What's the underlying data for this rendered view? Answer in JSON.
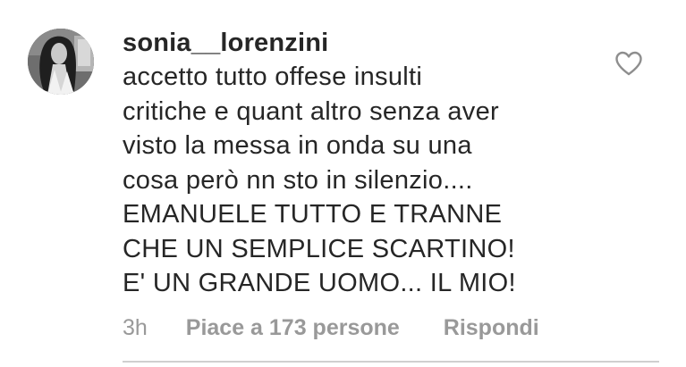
{
  "comment": {
    "username": "sonia__lorenzini",
    "text_lines": [
      "accetto tutto offese insulti",
      "critiche e quant altro senza aver",
      "visto la messa in onda su una",
      "cosa però nn sto in silenzio....",
      "EMANUELE TUTTO E TRANNE",
      "CHE UN SEMPLICE SCARTINO!",
      "E' UN GRANDE UOMO... IL MIO!"
    ],
    "time": "3h",
    "likes_label": "Piace a 173 persone",
    "reply_label": "Rispondi",
    "like_icon": "heart-outline-icon"
  },
  "colors": {
    "text": "#262626",
    "meta": "#999999",
    "divider": "#cfcfcf"
  }
}
